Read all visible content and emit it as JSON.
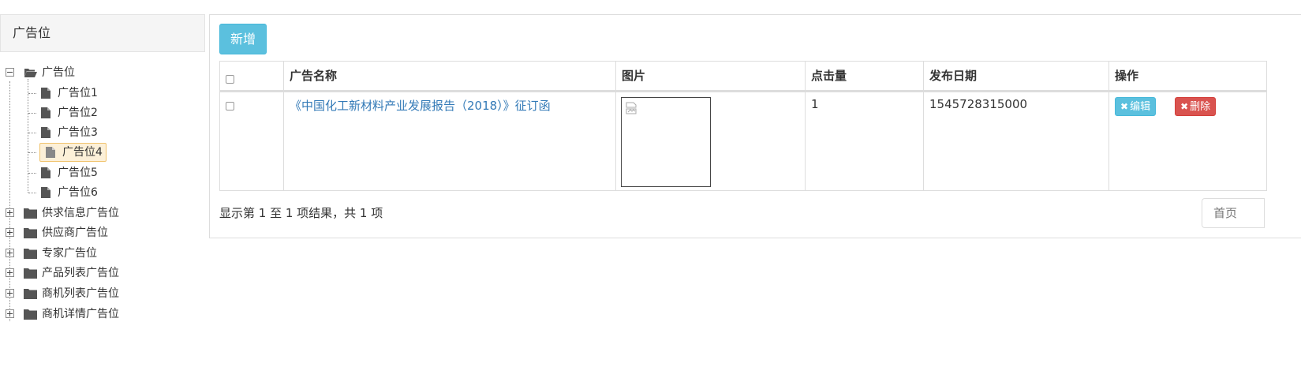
{
  "tree": {
    "heading": "广告位",
    "root": {
      "label": "广告位",
      "children": [
        "广告位1",
        "广告位2",
        "广告位3",
        "广告位4",
        "广告位5",
        "广告位6"
      ],
      "selected": "广告位4"
    },
    "groups": [
      "供求信息广告位",
      "供应商广告位",
      "专家广告位",
      "产品列表广告位",
      "商机列表广告位",
      "商机详情广告位"
    ]
  },
  "toolbar": {
    "add_label": "新增"
  },
  "table": {
    "columns": [
      "广告名称",
      "图片",
      "点击量",
      "发布日期",
      "操作"
    ],
    "rows": [
      {
        "name": "《中国化工新材料产业发展报告（2018）》征订函",
        "clicks": "1",
        "date": "1545728315000",
        "edit_label": "编辑",
        "delete_label": "删除"
      }
    ]
  },
  "summary": "显示第 1 至 1 项结果，共 1 项",
  "pager": {
    "first_label": "首页"
  },
  "colors": {
    "info": "#5bc0de",
    "danger": "#d9534f",
    "link": "#337ab7",
    "selected_bg": "#fcf0d8"
  }
}
